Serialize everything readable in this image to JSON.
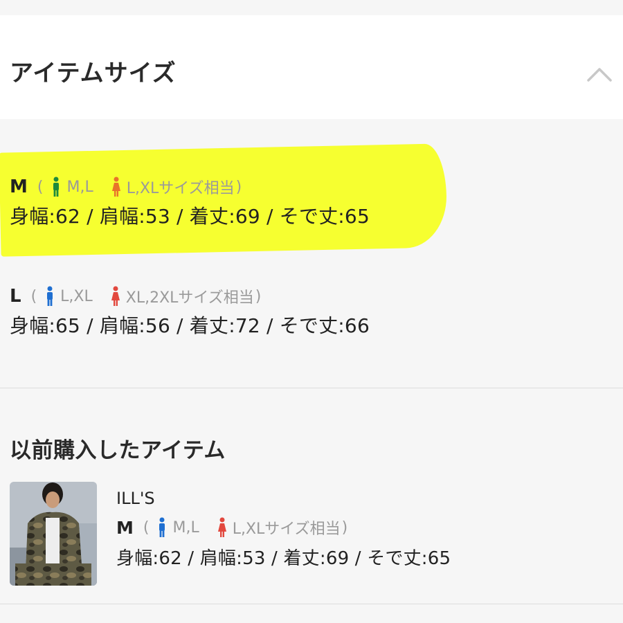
{
  "header": {
    "title": "アイテムサイズ"
  },
  "sizes": [
    {
      "size": "M",
      "paren_open": "(",
      "men": "M,L",
      "women": "L,XLサイズ相当",
      "paren_close": ")",
      "measurements": "身幅:62 / 肩幅:53 / 着丈:69 / そで丈:65",
      "men_color": "#1e8a3c",
      "women_color": "#e8732a"
    },
    {
      "size": "L",
      "paren_open": "(",
      "men": "L,XL",
      "women": "XL,2XLサイズ相当",
      "paren_close": ")",
      "measurements": "身幅:65 / 肩幅:56 / 着丈:72 / そで丈:66",
      "men_color": "#1f6fd1",
      "women_color": "#e2483e"
    }
  ],
  "previous": {
    "title": "以前購入したアイテム",
    "brand": "ILL'S",
    "size": "M",
    "paren_open": "(",
    "men": "M,L",
    "women": "L,XLサイズ相当",
    "paren_close": ")",
    "measurements": "身幅:62 / 肩幅:53 / 着丈:69 / そで丈:65",
    "men_color": "#1f6fd1",
    "women_color": "#e2483e"
  },
  "colors": {
    "highlight": "#f5ff1e",
    "background": "#f6f6f6"
  }
}
